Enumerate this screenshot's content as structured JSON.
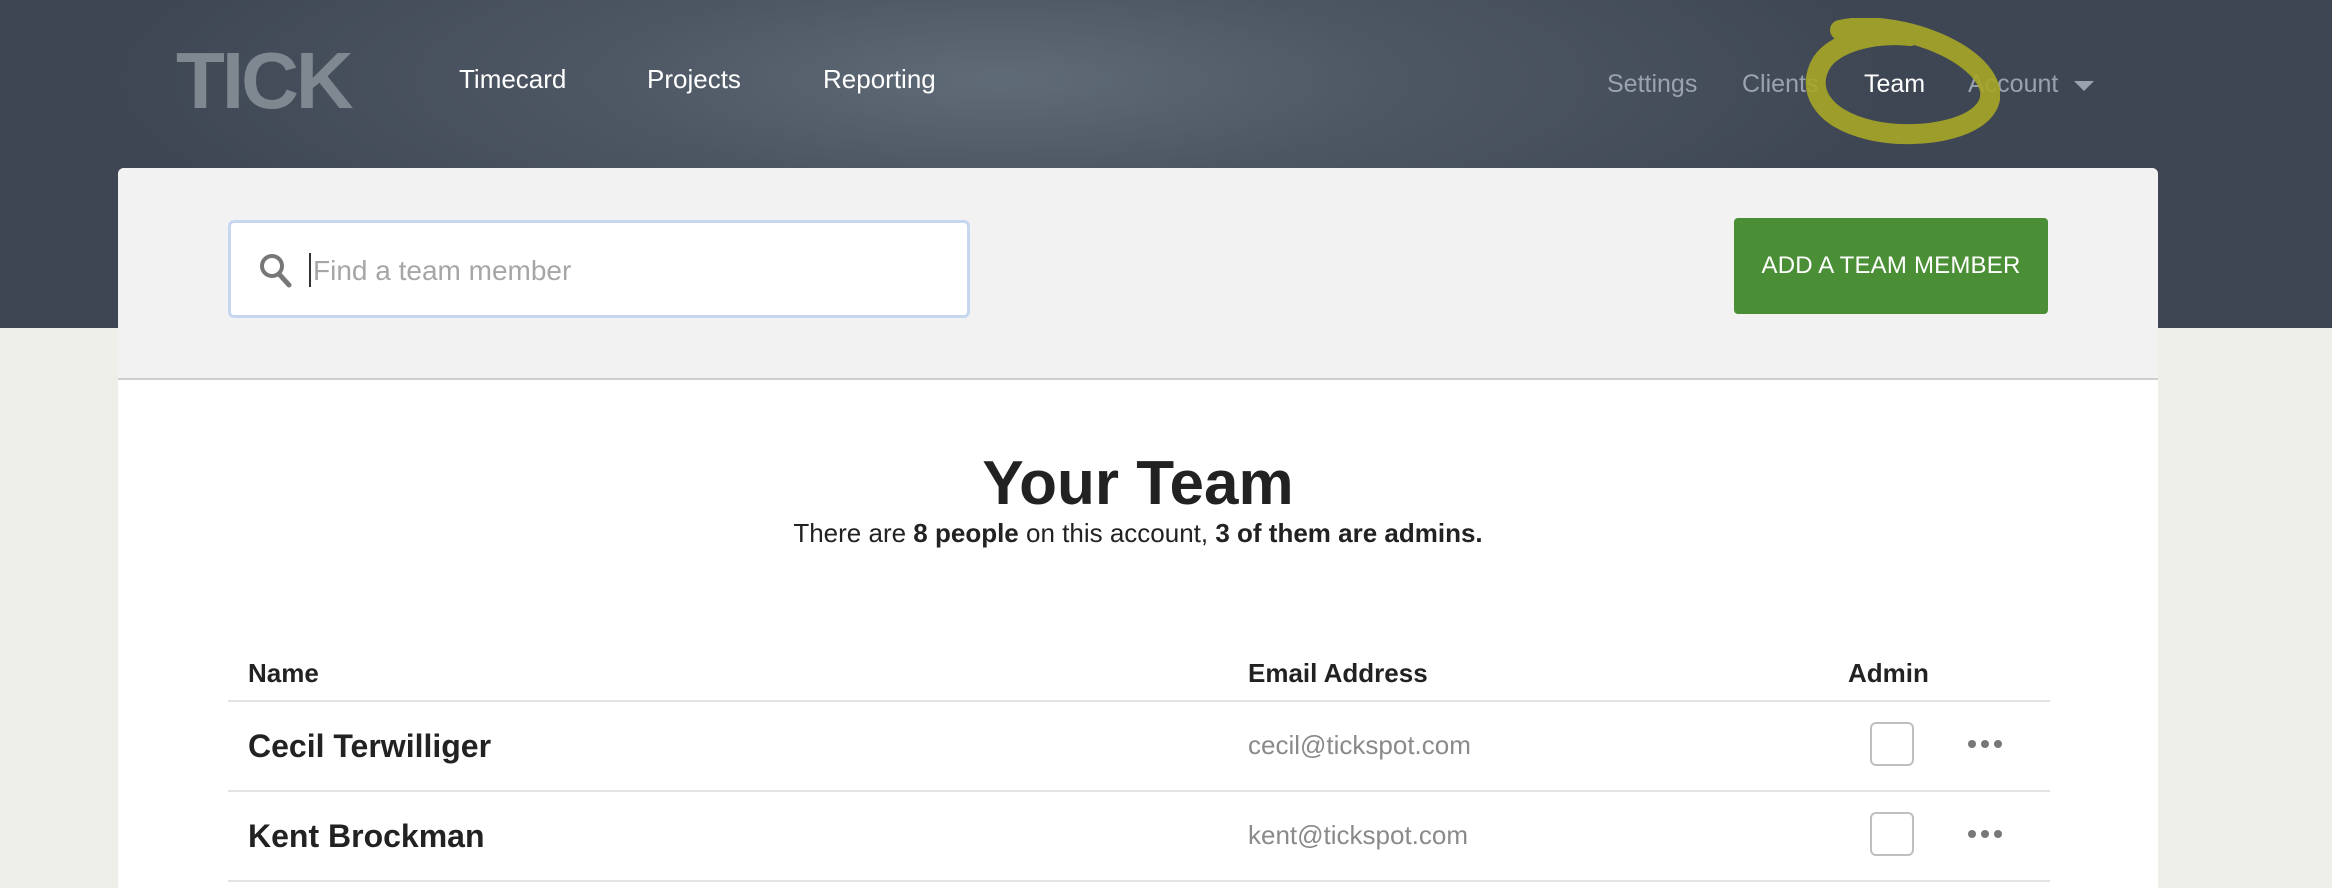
{
  "brand": {
    "logo": "TICK"
  },
  "main_nav": [
    {
      "label": "Timecard"
    },
    {
      "label": "Projects"
    },
    {
      "label": "Reporting"
    }
  ],
  "sub_nav": {
    "settings": "Settings",
    "clients": "Clients",
    "team": "Team",
    "account": "Account",
    "active": "Team"
  },
  "search": {
    "placeholder": "Find a team member",
    "value": ""
  },
  "add_button": {
    "label": "ADD A TEAM MEMBER"
  },
  "heading": {
    "title": "Your Team",
    "sub_pre": "There are ",
    "people_count": "8 people",
    "sub_mid": " on this account, ",
    "admins": "3 of them are admins."
  },
  "table": {
    "columns": {
      "name": "Name",
      "email": "Email Address",
      "admin": "Admin"
    },
    "rows": [
      {
        "name": "Cecil Terwilliger",
        "email": "cecil@tickspot.com",
        "admin": false
      },
      {
        "name": "Kent Brockman",
        "email": "kent@tickspot.com",
        "admin": false
      }
    ]
  },
  "colors": {
    "header_bg": "#4d5763",
    "button_green": "#4a8f35",
    "highlight_ring": "#a7a627"
  }
}
